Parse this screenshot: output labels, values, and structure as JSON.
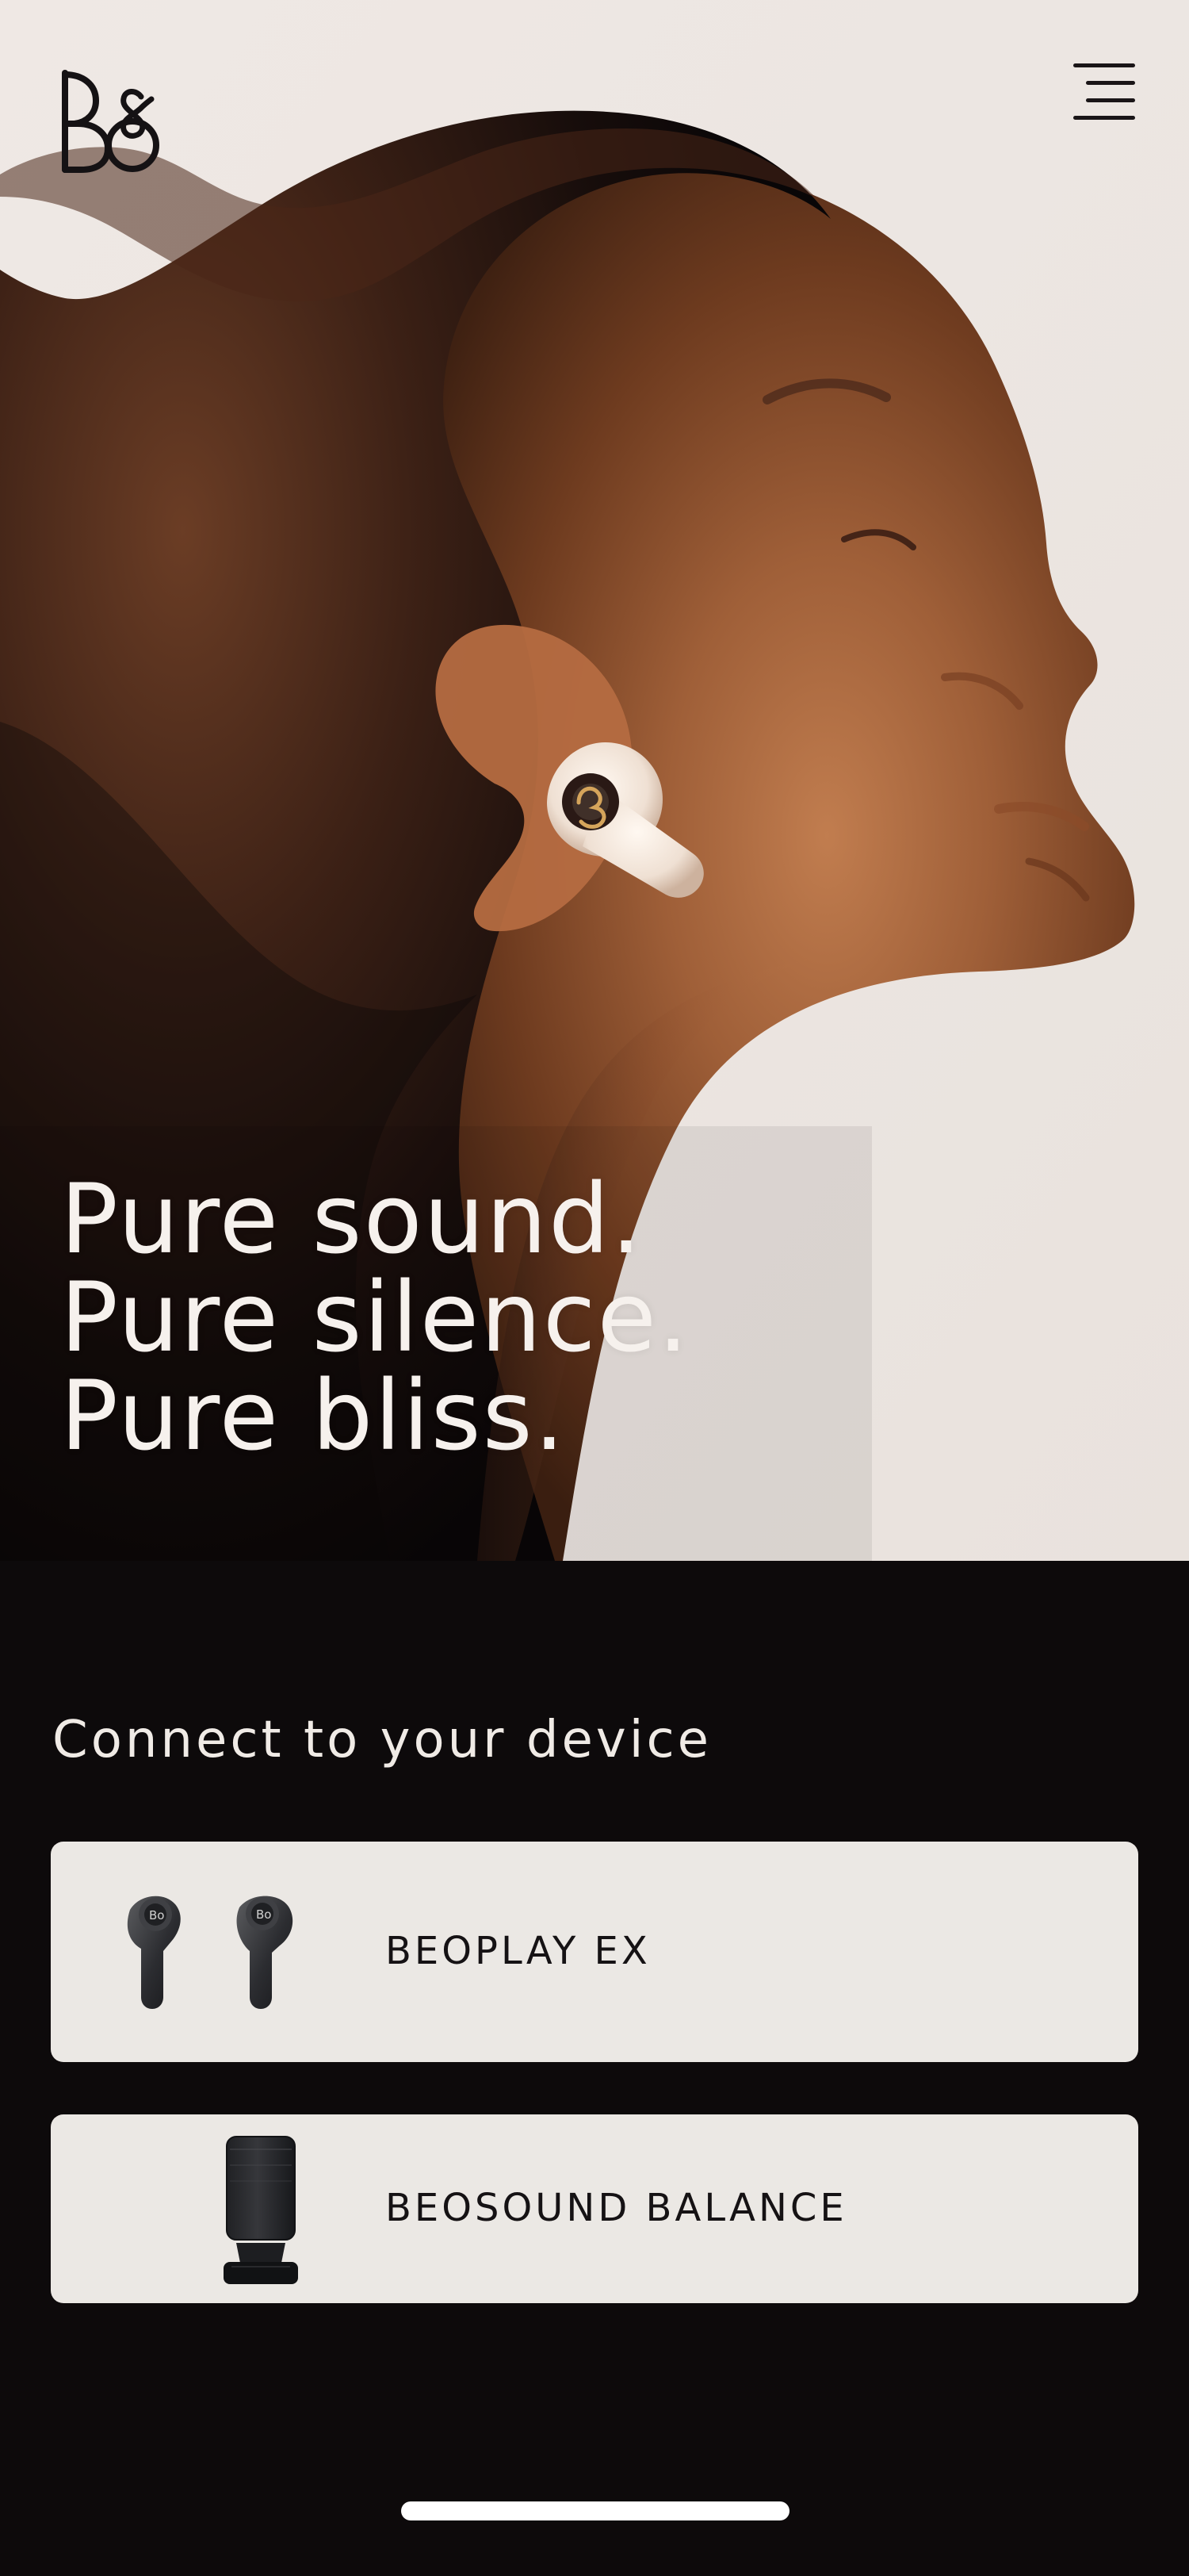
{
  "app": {
    "brand": "B&O"
  },
  "header": {
    "logo_icon": "bang-olufsen-logo-icon",
    "menu_icon": "hamburger-menu-icon"
  },
  "hero": {
    "headline_lines": [
      "Pure sound.",
      "Pure silence.",
      "Pure bliss."
    ]
  },
  "connect": {
    "title": "Connect to your device",
    "devices": [
      {
        "label": "BEOPLAY EX",
        "icon": "earbuds-icon"
      },
      {
        "label": "BEOSOUND BALANCE",
        "icon": "speaker-icon"
      }
    ]
  },
  "colors": {
    "background": "#0d0a0b",
    "card": "#ebe8e4",
    "text_light": "#f0ebe6",
    "text_dark": "#151214"
  }
}
